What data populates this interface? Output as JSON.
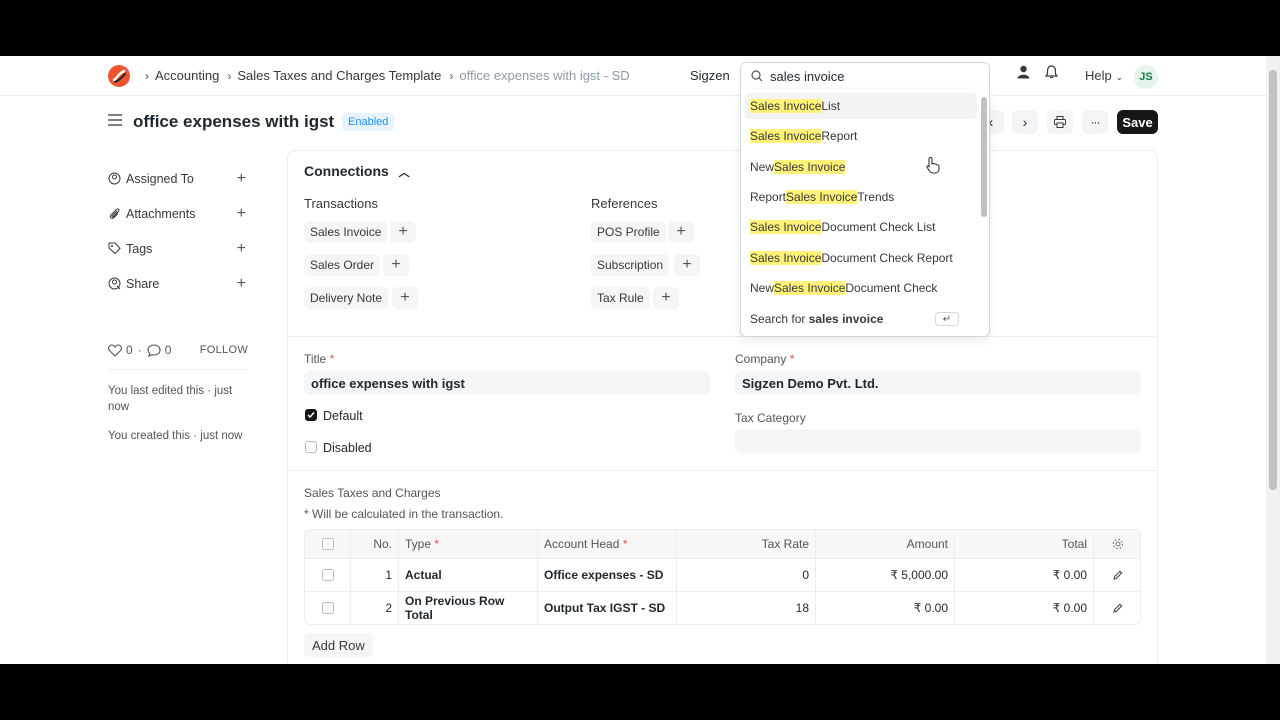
{
  "navbar": {
    "breadcrumbs": [
      "Accounting",
      "Sales Taxes and Charges Template"
    ],
    "current_crumb": "office expenses with igst - SD",
    "brand": "Sigzen",
    "search_value": "sales invoice",
    "help_label": "Help",
    "avatar_initials": "JS"
  },
  "search_dropdown": {
    "items": [
      {
        "pre": "",
        "hl": "Sales Invoice",
        "post": " List"
      },
      {
        "pre": "",
        "hl": "Sales Invoice",
        "post": " Report"
      },
      {
        "pre": "New ",
        "hl": "Sales Invoice",
        "post": ""
      },
      {
        "pre": "Report ",
        "hl": "Sales Invoice",
        "post": " Trends"
      },
      {
        "pre": "",
        "hl": "Sales Invoice",
        "post": " Document Check List"
      },
      {
        "pre": "",
        "hl": "Sales Invoice",
        "post": " Document Check Report"
      },
      {
        "pre": "New ",
        "hl": "Sales Invoice",
        "post": " Document Check"
      }
    ],
    "search_for_prefix": "Search for ",
    "search_for_term": "sales invoice",
    "enter_key": "↵"
  },
  "page": {
    "title": "office expenses with igst",
    "status": "Enabled",
    "save_label": "Save"
  },
  "sidebar": {
    "items": [
      "Assigned To",
      "Attachments",
      "Tags",
      "Share"
    ],
    "likes": "0",
    "comments": "0",
    "follow_label": "FOLLOW",
    "last_edited": "You last edited this · just now",
    "created": "You created this · just now"
  },
  "connections": {
    "title": "Connections",
    "transactions_label": "Transactions",
    "references_label": "References",
    "transactions": [
      "Sales Invoice",
      "Sales Order",
      "Delivery Note"
    ],
    "references": [
      "POS Profile",
      "Subscription",
      "Tax Rule"
    ]
  },
  "form": {
    "title_label": "Title",
    "title_value": "office expenses with igst",
    "company_label": "Company",
    "company_value": "Sigzen Demo Pvt. Ltd.",
    "default_label": "Default",
    "disabled_label": "Disabled",
    "tax_category_label": "Tax Category",
    "tax_category_value": ""
  },
  "taxes": {
    "section_label": "Sales Taxes and Charges",
    "note": "* Will be calculated in the transaction.",
    "columns": {
      "no": "No.",
      "type": "Type",
      "account": "Account Head",
      "rate": "Tax Rate",
      "amount": "Amount",
      "total": "Total"
    },
    "rows": [
      {
        "no": "1",
        "type": "Actual",
        "account": "Office expenses - SD",
        "rate": "0",
        "amount": "₹ 5,000.00",
        "total": "₹ 0.00"
      },
      {
        "no": "2",
        "type": "On Previous Row Total",
        "account": "Output Tax IGST - SD",
        "rate": "18",
        "amount": "₹ 0.00",
        "total": "₹ 0.00"
      }
    ],
    "add_row_label": "Add Row"
  },
  "colors": {
    "accent": "#171717",
    "status_blue": "#2490ef",
    "highlight": "#fff27a",
    "logo": "#f0532f"
  }
}
